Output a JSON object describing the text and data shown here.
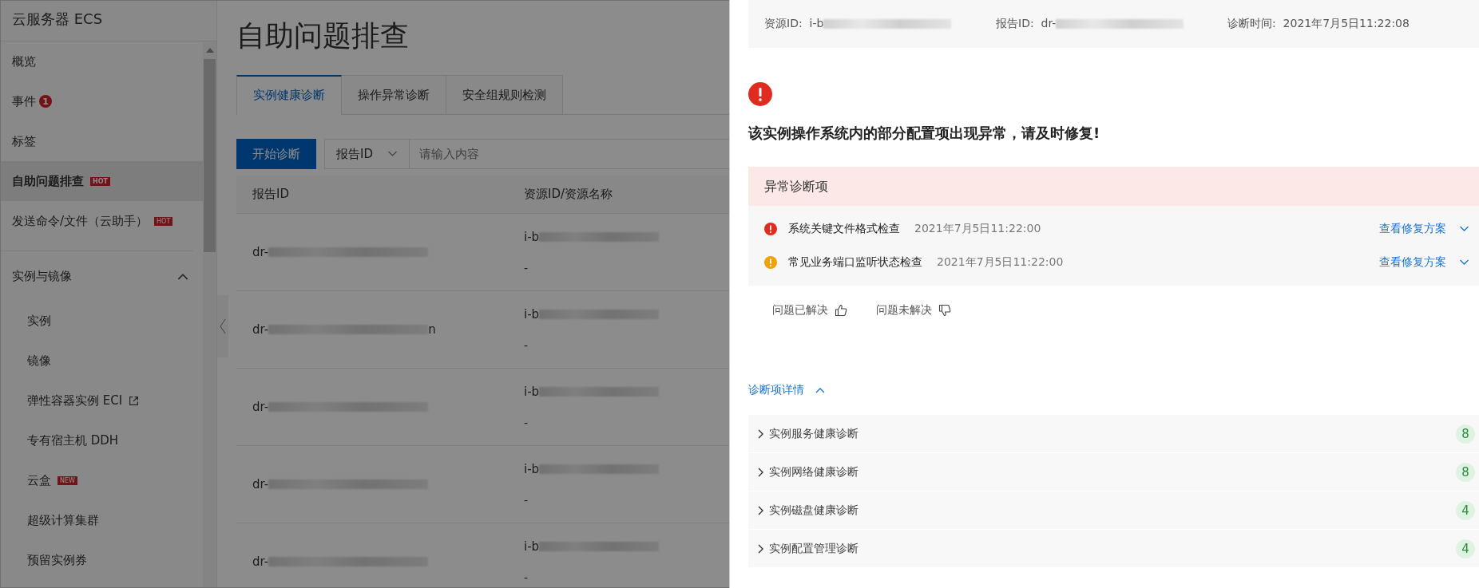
{
  "sidebar": {
    "title": "云服务器 ECS",
    "items": [
      {
        "label": "概览",
        "selected": false
      },
      {
        "label": "事件",
        "badge": {
          "text": "1",
          "kind": "count"
        },
        "selected": false
      },
      {
        "label": "标签",
        "selected": false
      },
      {
        "label": "自助问题排查",
        "badge": {
          "text": "HOT",
          "kind": "tag"
        },
        "selected": true
      },
      {
        "label": "发送命令/文件（云助手）",
        "badge": {
          "text": "HOT",
          "kind": "tag"
        },
        "selected": false
      }
    ],
    "group": {
      "label": "实例与镜像",
      "expanded": true,
      "children": [
        {
          "label": "实例",
          "selected": false
        },
        {
          "label": "镜像",
          "selected": false
        },
        {
          "label": "弹性容器实例 ECI",
          "external": true,
          "selected": false
        },
        {
          "label": "专有宿主机 DDH",
          "selected": false
        },
        {
          "label": "云盒",
          "badge": {
            "text": "NEW",
            "kind": "tag"
          },
          "selected": false
        },
        {
          "label": "超级计算集群",
          "selected": false
        },
        {
          "label": "预留实例券",
          "selected": false
        }
      ]
    }
  },
  "page": {
    "title": "自助问题排查",
    "tabs": [
      {
        "label": "实例健康诊断",
        "selected": true
      },
      {
        "label": "操作异常诊断",
        "selected": false
      },
      {
        "label": "安全组规则检测",
        "selected": false
      }
    ],
    "start_button": "开始诊断",
    "search_select": "报告ID",
    "search": {
      "placeholder": "请输入内容"
    },
    "table": {
      "columns": [
        "报告ID",
        "资源ID/资源名称"
      ],
      "rows": [
        {
          "report_id": "dr-",
          "report_suffix": "",
          "resource_id": "i-b",
          "resource_name": "-"
        },
        {
          "report_id": "dr-",
          "report_suffix": "n",
          "resource_id": "i-b",
          "resource_name": "-"
        },
        {
          "report_id": "dr-",
          "report_suffix": "",
          "resource_id": "i-b",
          "resource_name": "-"
        },
        {
          "report_id": "dr-",
          "report_suffix": "",
          "resource_id": "i-b",
          "resource_name": "-"
        },
        {
          "report_id": "dr-",
          "report_suffix": "",
          "resource_id": "i-b",
          "resource_name": "-"
        }
      ]
    }
  },
  "drawer": {
    "info": [
      {
        "label": "资源ID:",
        "value": "i-b",
        "blurred": true
      },
      {
        "label": "报告ID:",
        "value": "dr-",
        "blurred": true
      },
      {
        "label": "诊断时间:",
        "value": "2021年7月5日11:22:08",
        "blurred": false
      }
    ],
    "headline": "该实例操作系统内的部分配置项出现异常，请及时修复!",
    "anomalies": {
      "title": "异常诊断项",
      "items": [
        {
          "kind": "error",
          "name": "系统关键文件格式检查",
          "time": "2021年7月5日11:22:00",
          "link": "查看修复方案"
        },
        {
          "kind": "warning",
          "name": "常见业务端口监听状态检查",
          "time": "2021年7月5日11:22:00",
          "link": "查看修复方案"
        }
      ]
    },
    "feedback": [
      "问题已解决",
      "问题未解决"
    ],
    "details": {
      "label": "诊断项详情",
      "expanded": true,
      "rows": [
        {
          "name": "实例服务健康诊断",
          "count": "8"
        },
        {
          "name": "实例网络健康诊断",
          "count": "8"
        },
        {
          "name": "实例磁盘健康诊断",
          "count": "4"
        },
        {
          "name": "实例配置管理诊断",
          "count": "4"
        }
      ]
    }
  }
}
